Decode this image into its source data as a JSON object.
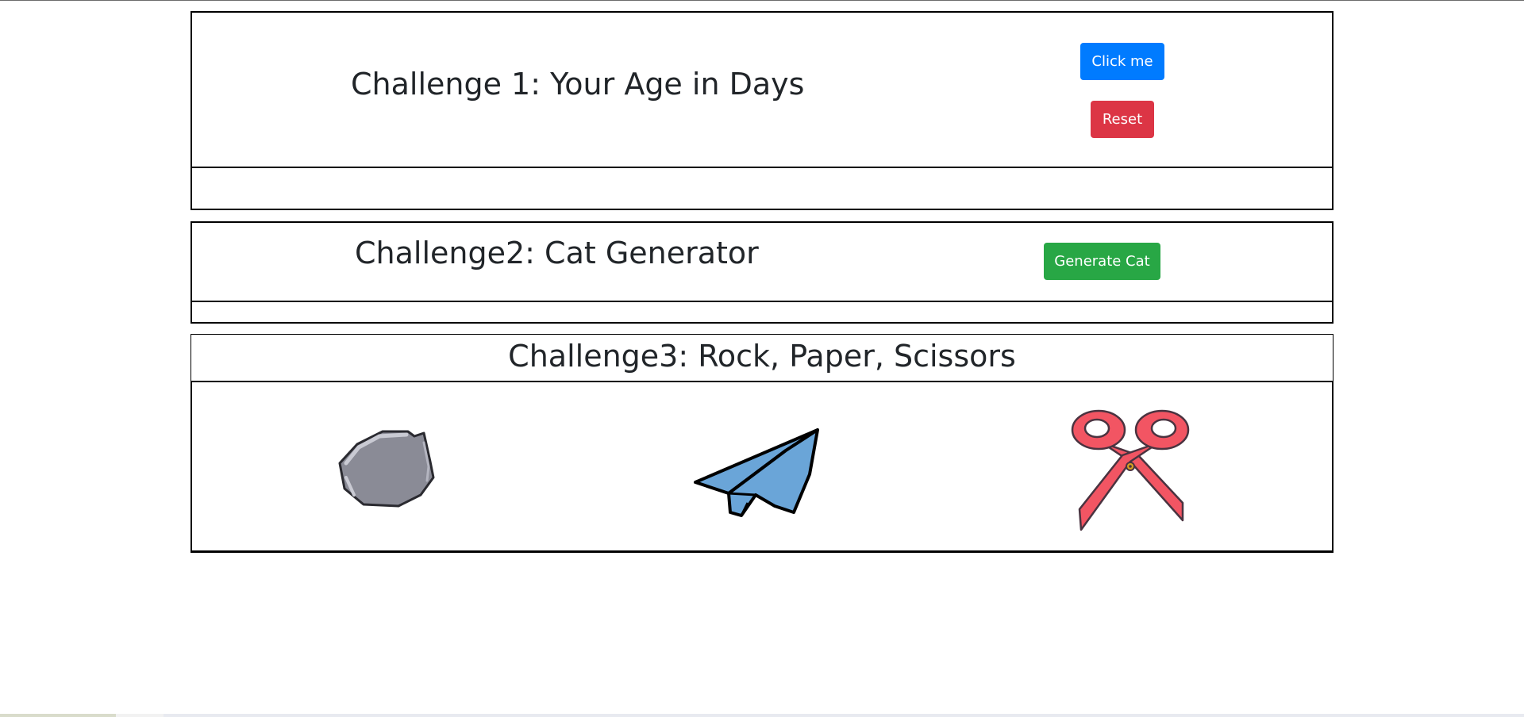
{
  "challenge1": {
    "title": "Challenge 1: Your Age in Days",
    "click_label": "Click me",
    "reset_label": "Reset"
  },
  "challenge2": {
    "title": "Challenge2: Cat Generator",
    "generate_label": "Generate Cat"
  },
  "challenge3": {
    "title": "Challenge3: Rock, Paper, Scissors",
    "choices": [
      "rock-icon",
      "paper-airplane-icon",
      "scissors-icon"
    ]
  },
  "colors": {
    "primary": "#007bff",
    "danger": "#dc3545",
    "success": "#28a745",
    "rock": "#8a8b96",
    "paper": "#6aa5d8",
    "scissors": "#f25563"
  }
}
